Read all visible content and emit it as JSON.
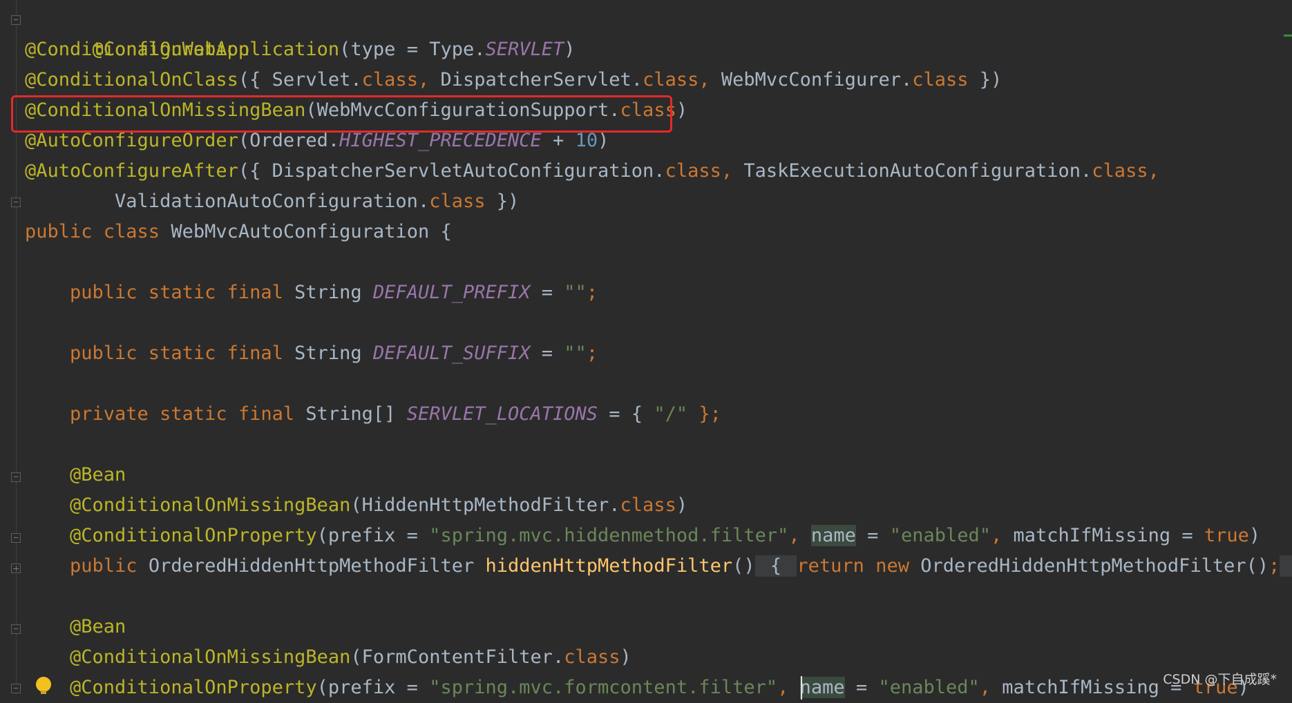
{
  "code": {
    "l1": {
      "ann": "@Configuration"
    },
    "l2": {
      "ann": "@ConditionalOnWebApplication",
      "p1": "(type = Type.",
      "cst": "SERVLET",
      "p2": ")"
    },
    "l3": {
      "ann": "@ConditionalOnClass",
      "p1": "({ Servlet.",
      "kw1": "class, ",
      "p2": "DispatcherServlet.",
      "kw2": "class, ",
      "p3": "WebMvcConfigurer.",
      "kw3": "class",
      "p4": " })"
    },
    "l4": {
      "ann": "@ConditionalOnMissingBean",
      "p1": "(WebMvcConfigurationSupport.",
      "kw": "class",
      "p2": ")"
    },
    "l5": {
      "ann": "@AutoConfigureOrder",
      "p1": "(Ordered.",
      "cst": "HIGHEST_PRECEDENCE",
      "p2": " + ",
      "num": "10",
      "p3": ")"
    },
    "l6": {
      "ann": "@AutoConfigureAfter",
      "p1": "({ DispatcherServletAutoConfiguration.",
      "kw1": "class, ",
      "p2": "TaskExecutionAutoConfiguration.",
      "kw2": "class,"
    },
    "l7": {
      "p1": "        ValidationAutoConfiguration.",
      "kw": "class",
      "p2": " })"
    },
    "l8": {
      "kw": "public class ",
      "p1": "WebMvcAutoConfiguration {"
    },
    "l10": {
      "kw": "    public static final ",
      "p1": "String ",
      "cst": "DEFAULT_PREFIX",
      "p2": " = ",
      "str": "\"\"",
      "p3": ";"
    },
    "l12": {
      "kw": "    public static final ",
      "p1": "String ",
      "cst": "DEFAULT_SUFFIX",
      "p2": " = ",
      "str": "\"\"",
      "p3": ";"
    },
    "l14": {
      "kw": "    private static final ",
      "p1": "String[] ",
      "cst": "SERVLET_LOCATIONS",
      "p2": " = { ",
      "str": "\"/\"",
      "p3": " };"
    },
    "l16": {
      "ann": "    @Bean"
    },
    "l17": {
      "ann": "    @ConditionalOnMissingBean",
      "p1": "(HiddenHttpMethodFilter.",
      "kw": "class",
      "p2": ")"
    },
    "l18": {
      "ann": "    @ConditionalOnProperty",
      "p1": "(prefix = ",
      "str1": "\"spring.mvc.hiddenmethod.filter\"",
      "kw1": ", ",
      "hl": "name",
      "p2": " = ",
      "str2": "\"enabled\"",
      "kw2": ", ",
      "p3": "matchIfMissing = ",
      "kw3": "true",
      "p4": ")"
    },
    "l19": {
      "kw1": "    public ",
      "p1": "OrderedHiddenHttpMethodFilter ",
      "meth": "hiddenHttpMethodFilter",
      "p2": "()",
      "f1": " { ",
      "kw2": "return new ",
      "p3": "OrderedHiddenHttpMethodFilter()",
      "kw3": ";",
      "f2": " }"
    },
    "l21": {
      "ann": "    @Bean"
    },
    "l22": {
      "ann": "    @ConditionalOnMissingBean",
      "p1": "(FormContentFilter.",
      "kw": "class",
      "p2": ")"
    },
    "l23": {
      "ann": "    @ConditionalOnProperty",
      "p1": "(prefix = ",
      "str1": "\"spring.mvc.formcontent.filter\"",
      "kw1": ", ",
      "hl": "name",
      "p2": " = ",
      "str2": "\"enabled\"",
      "kw2": ", ",
      "p3": "matchIfMissing = ",
      "kw3": "true",
      "p4": ")"
    }
  },
  "watermark": "CSDN @下自成蹊*",
  "colors": {
    "background": "#2b2b2b",
    "annotation": "#bbb529",
    "keyword": "#cc7832",
    "constant": "#9876aa",
    "string": "#6a8759",
    "number": "#6897bb",
    "method": "#ffc66d",
    "highlight_box": "#e5292c"
  },
  "icons": [
    "fold-marker-icon",
    "lightbulb-icon"
  ]
}
